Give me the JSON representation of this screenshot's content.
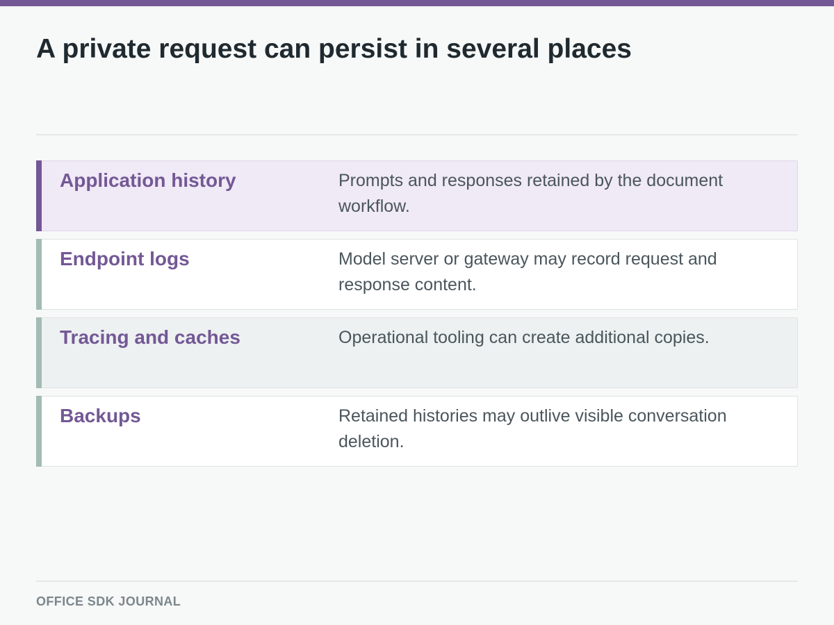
{
  "page": {
    "title": "A private request can persist in several places",
    "accent_color": "#735895",
    "neutral_accent_color": "#a3bbb3"
  },
  "rows": [
    {
      "label": "Application history",
      "description": "Prompts and responses retained by the document workflow.",
      "highlighted": true
    },
    {
      "label": "Endpoint logs",
      "description": "Model server or gateway may record request and response content.",
      "highlighted": false
    },
    {
      "label": "Tracing and caches",
      "description": "Operational tooling can create additional copies.",
      "highlighted": false
    },
    {
      "label": "Backups",
      "description": "Retained histories may outlive visible conversation deletion.",
      "highlighted": false
    }
  ],
  "footer": {
    "text": "OFFICE SDK JOURNAL"
  }
}
